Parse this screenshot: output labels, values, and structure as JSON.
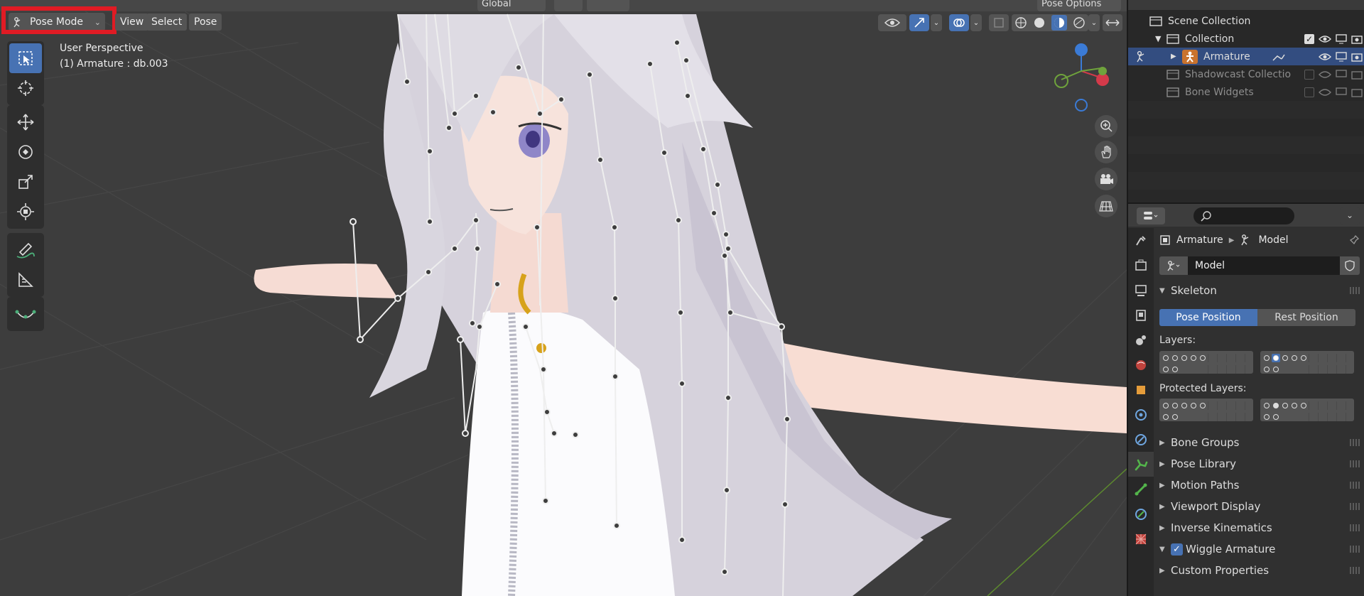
{
  "viewport": {
    "header_left_text": "Global",
    "header_right_label": "Pose Options",
    "mode": "Pose Mode",
    "menus": [
      "View",
      "Select",
      "Pose"
    ],
    "perspective_label": "User Perspective",
    "object_label": "(1) Armature : db.003",
    "tools": [
      "select-box-tool",
      "cursor-tool",
      "move-tool",
      "rotate-tool",
      "scale-tool",
      "transform-tool",
      "annotate-tool",
      "measure-tool",
      "bone-envelope-tool"
    ],
    "gizmo_axes": {
      "z": "Z",
      "x": "X"
    },
    "colors": {
      "background": "#3d3d3d",
      "highlight": "#e01b24",
      "accent": "#4772b3"
    }
  },
  "outliner": {
    "rows": [
      {
        "label": "Scene Collection",
        "state": "normal"
      },
      {
        "label": "Collection",
        "state": "normal"
      },
      {
        "label": "Armature",
        "state": "selected"
      },
      {
        "label": "Shadowcast Collection",
        "state": "dim"
      },
      {
        "label": "Bone Widgets",
        "state": "dim"
      }
    ]
  },
  "properties": {
    "breadcrumb": [
      "Armature",
      "Model"
    ],
    "data_name": "Model",
    "skeleton": {
      "title": "Skeleton",
      "pose_position": "Pose Position",
      "rest_position": "Rest Position",
      "layers_label": "Layers:",
      "protected_layers_label": "Protected Layers:"
    },
    "collapsed_panels": [
      "Bone Groups",
      "Pose Library",
      "Motion Paths",
      "Viewport Display",
      "Inverse Kinematics"
    ],
    "wiggle_panel": "Wiggle Armature",
    "custom_properties": "Custom Properties"
  }
}
